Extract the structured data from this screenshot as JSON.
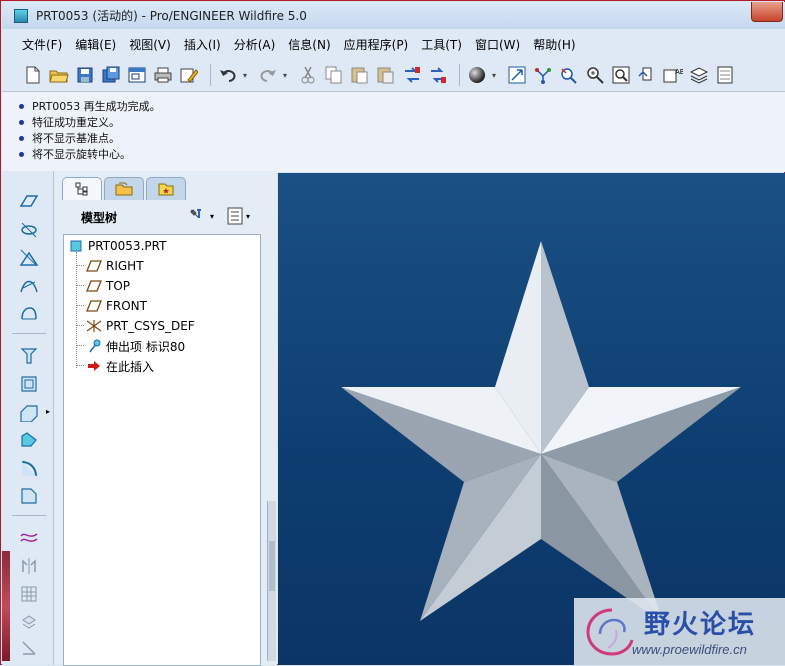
{
  "window": {
    "title": "PRT0053 (活动的) - Pro/ENGINEER Wildfire 5.0"
  },
  "menu": [
    "文件(F)",
    "编辑(E)",
    "视图(V)",
    "插入(I)",
    "分析(A)",
    "信息(N)",
    "应用程序(P)",
    "工具(T)",
    "窗口(W)",
    "帮助(H)"
  ],
  "toolbar": {
    "icons": [
      "new-file-icon",
      "open-folder-icon",
      "save-icon",
      "save-copy-icon",
      "window-icon",
      "print-icon",
      "email-icon",
      "undo-icon",
      "redo-icon",
      "cut-icon",
      "copy-icon",
      "paste-icon",
      "paste-special-icon",
      "regenerate-icon",
      "regenerate-manager-icon",
      "shading-sphere-icon",
      "orient-icon",
      "spin-center-icon",
      "find-icon",
      "zoom-in-icon",
      "zoom-window-icon",
      "reorient-icon",
      "datum-display-icon",
      "layers-icon",
      "model-display-icon"
    ]
  },
  "messages": [
    "PRT0053 再生成功完成。",
    "特征成功重定义。",
    "将不显示基准点。",
    "将不显示旋转中心。"
  ],
  "model_tree": {
    "title": "模型树",
    "root": "PRT0053.PRT",
    "items": [
      {
        "label": "RIGHT",
        "icon": "datum-plane-icon"
      },
      {
        "label": "TOP",
        "icon": "datum-plane-icon"
      },
      {
        "label": "FRONT",
        "icon": "datum-plane-icon"
      },
      {
        "label": "PRT_CSYS_DEF",
        "icon": "coordinate-system-icon"
      },
      {
        "label": "伸出项 标识80",
        "icon": "protrusion-icon"
      },
      {
        "label": "在此插入",
        "icon": "insert-here-arrow-icon"
      }
    ]
  },
  "watermark": {
    "text": "野火论坛",
    "url": "www.proewildfire.cn"
  },
  "colors": {
    "graphics_bg": "#0d3d70",
    "star_light": "#e8eef4",
    "star_dark": "#8e9aa6",
    "watermark_text": "#2a4fa8"
  }
}
